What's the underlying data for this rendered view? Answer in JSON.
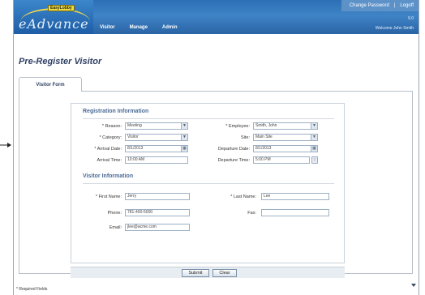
{
  "header": {
    "logo_badge": "EasyLobby",
    "logo_text": "eAdvance",
    "top_links": [
      "Change Password",
      "|",
      "Logoff"
    ],
    "version": "9.0",
    "welcome": "Welcome John Smith",
    "nav": [
      "Visitor",
      "Manage",
      "Admin"
    ]
  },
  "page": {
    "title": "Pre-Register Visitor",
    "tab_label": "Visitor Form"
  },
  "registration": {
    "section_title": "Registration Information",
    "reason_label": "* Reason:",
    "reason_value": "Meeting",
    "employee_label": "* Employee:",
    "employee_value": "Smith, John",
    "category_label": "* Category:",
    "category_value": "Visitor",
    "site_label": "Site:",
    "site_value": "Main Site",
    "arrival_date_label": "* Arrival Date:",
    "arrival_date_value": "8/1/2013",
    "departure_date_label": "Departure Date:",
    "departure_date_value": "8/1/2013",
    "arrival_time_label": "Arrival Time:",
    "arrival_time_value": "10:00 AM",
    "departure_time_label": "Departure Time:",
    "departure_time_value": "5:00 PM"
  },
  "visitor": {
    "section_title": "Visitor Information",
    "first_name_label": "* First Name:",
    "first_name_value": "Jerry",
    "last_name_label": "* Last Name:",
    "last_name_value": "Lee",
    "phone_label": "Phone:",
    "phone_value": "781-400-5000",
    "fax_label": "Fax:",
    "fax_value": "",
    "email_label": "Email:",
    "email_value": "jlee@acme.com"
  },
  "buttons": {
    "submit": "Submit",
    "clear": "Clear"
  },
  "footer": {
    "required_note": "* Required Fields"
  },
  "colors": {
    "header": "#2d6fb4",
    "accent": "#f2de3a",
    "section_title": "#4a6a96"
  }
}
